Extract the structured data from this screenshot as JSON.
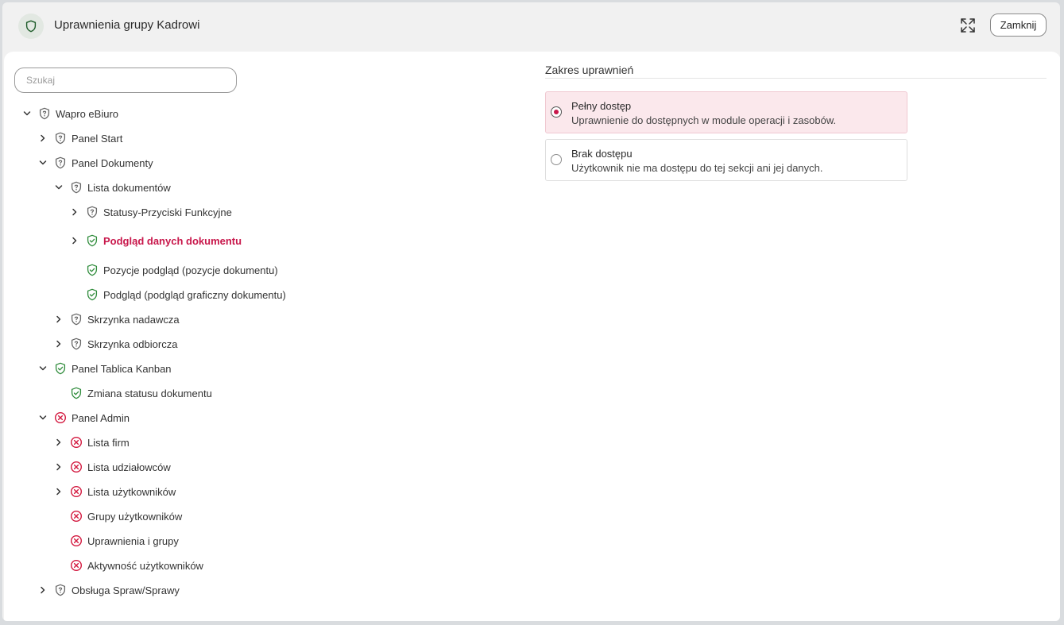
{
  "header": {
    "title": "Uprawnienia grupy Kadrowi",
    "expand_icon": "expand-icon",
    "close_label": "Zamknij"
  },
  "search": {
    "placeholder": "Szukaj",
    "value": ""
  },
  "tree": [
    {
      "label": "Wapro eBiuro",
      "level": 0,
      "chevron": "down",
      "status": "partial"
    },
    {
      "label": "Panel Start",
      "level": 1,
      "chevron": "right",
      "status": "partial"
    },
    {
      "label": "Panel Dokumenty",
      "level": 1,
      "chevron": "down",
      "status": "partial"
    },
    {
      "label": "Lista dokumentów",
      "level": 2,
      "chevron": "down",
      "status": "partial"
    },
    {
      "label": "Statusy-Przyciski Funkcyjne",
      "level": 3,
      "chevron": "right",
      "status": "partial"
    },
    {
      "label": "Podgląd danych dokumentu",
      "level": 3,
      "chevron": "right",
      "status": "full",
      "selected": true
    },
    {
      "label": "Pozycje podgląd (pozycje dokumentu)",
      "level": 3,
      "chevron": "none",
      "status": "full"
    },
    {
      "label": "Podgląd (podgląd graficzny dokumentu)",
      "level": 3,
      "chevron": "none",
      "status": "full"
    },
    {
      "label": "Skrzynka nadawcza",
      "level": 2,
      "chevron": "right",
      "status": "partial"
    },
    {
      "label": "Skrzynka odbiorcza",
      "level": 2,
      "chevron": "right",
      "status": "partial"
    },
    {
      "label": "Panel Tablica Kanban",
      "level": 1,
      "chevron": "down",
      "status": "full"
    },
    {
      "label": "Zmiana statusu dokumentu",
      "level": 2,
      "chevron": "none",
      "status": "full"
    },
    {
      "label": "Panel Admin",
      "level": 1,
      "chevron": "down",
      "status": "none"
    },
    {
      "label": "Lista firm",
      "level": 2,
      "chevron": "right",
      "status": "none"
    },
    {
      "label": "Lista udziałowców",
      "level": 2,
      "chevron": "right",
      "status": "none"
    },
    {
      "label": "Lista użytkowników",
      "level": 2,
      "chevron": "right",
      "status": "none"
    },
    {
      "label": "Grupy użytkowników",
      "level": 2,
      "chevron": "none",
      "status": "none"
    },
    {
      "label": "Uprawnienia i grupy",
      "level": 2,
      "chevron": "none",
      "status": "none"
    },
    {
      "label": "Aktywność użytkowników",
      "level": 2,
      "chevron": "none",
      "status": "none"
    },
    {
      "label": "Obsługa Spraw/Sprawy",
      "level": 1,
      "chevron": "right",
      "status": "partial"
    }
  ],
  "scope": {
    "title": "Zakres uprawnień",
    "options": [
      {
        "title": "Pełny dostęp",
        "description": "Uprawnienie do dostępnych w module operacji i zasobów.",
        "selected": true
      },
      {
        "title": "Brak dostępu",
        "description": "Użytkownik nie ma dostępu do tej sekcji ani jej danych.",
        "selected": false
      }
    ]
  },
  "colors": {
    "accent": "#c8174b",
    "full_access": "#2e8b3a",
    "partial_access": "#666666",
    "no_access": "#d3193f",
    "selected_option_bg": "#fbe8ec"
  },
  "icons": {
    "partial": "shield-partial-icon",
    "full": "shield-check-icon",
    "none": "x-circle-icon"
  }
}
